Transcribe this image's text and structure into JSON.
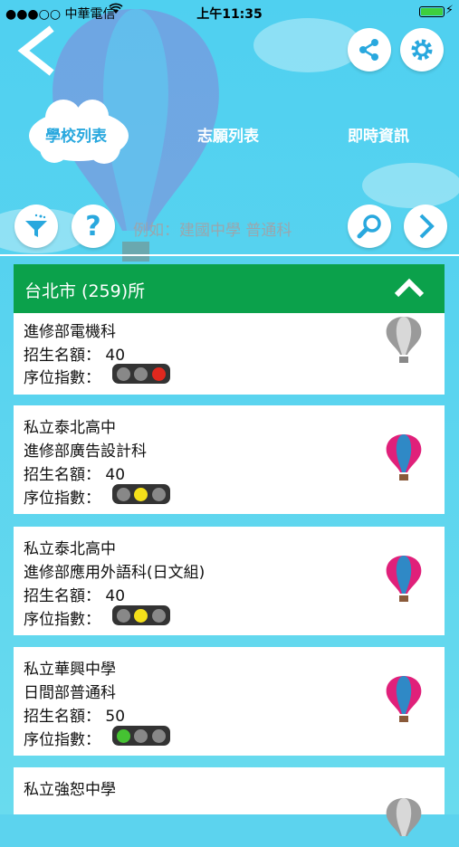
{
  "status_bar": {
    "carrier": "●●●○○ 中華電信",
    "time": "上午11:35"
  },
  "tabs": [
    {
      "label": "學校列表",
      "active": true
    },
    {
      "label": "志願列表",
      "active": false
    },
    {
      "label": "即時資訊",
      "active": false
    }
  ],
  "search": {
    "placeholder": "例如：建國中學 普通科"
  },
  "city_header": {
    "title": "台北市 (259)所"
  },
  "colors": {
    "accent": "#0ba14b",
    "sky": "#58d3ef",
    "tab_active": "#29a8de"
  },
  "cards": [
    {
      "school": "",
      "dept": "進修部電機科",
      "quota_label": "招生名額：",
      "quota": "40",
      "rank_label": "序位指數：",
      "rank_light": "red",
      "balloon": "gray-balloon-icon"
    },
    {
      "school": "私立泰北高中",
      "dept": "進修部廣告設計科",
      "quota_label": "招生名額：",
      "quota": "40",
      "rank_label": "序位指數：",
      "rank_light": "yellow",
      "balloon": "pink-balloon-icon"
    },
    {
      "school": "私立泰北高中",
      "dept": "進修部應用外語科(日文組)",
      "quota_label": "招生名額：",
      "quota": "40",
      "rank_label": "序位指數：",
      "rank_light": "yellow",
      "balloon": "pink-balloon-icon"
    },
    {
      "school": "私立華興中學",
      "dept": "日間部普通科",
      "quota_label": "招生名額：",
      "quota": "50",
      "rank_label": "序位指數：",
      "rank_light": "green",
      "balloon": "pink-balloon-icon"
    },
    {
      "school": "私立強恕中學",
      "dept": "",
      "quota_label": "",
      "quota": "",
      "rank_label": "",
      "rank_light": "",
      "balloon": "gray-balloon-icon"
    }
  ]
}
